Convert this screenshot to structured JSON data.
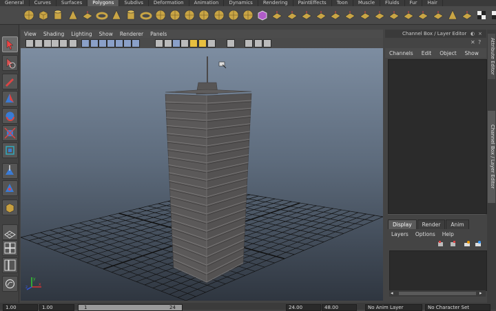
{
  "shelf": {
    "tabs": [
      "General",
      "Curves",
      "Surfaces",
      "Polygons",
      "Subdivs",
      "Deformation",
      "Animation",
      "Dynamics",
      "Rendering",
      "PaintEffects",
      "Toon",
      "Muscle",
      "Fluids",
      "Fur",
      "Hair"
    ],
    "active_tab": "Polygons"
  },
  "viewport": {
    "menus": [
      "View",
      "Shading",
      "Lighting",
      "Show",
      "Renderer",
      "Panels"
    ]
  },
  "channel_box": {
    "title": "Channel Box / Layer Editor",
    "menus": [
      "Channels",
      "Edit",
      "Object",
      "Show"
    ]
  },
  "side_tabs": [
    "Attribute Editor",
    "Channel Box / Layer Editor"
  ],
  "layer_editor": {
    "tabs": [
      "Display",
      "Render",
      "Anim"
    ],
    "active_tab": "Display",
    "menus": [
      "Layers",
      "Options",
      "Help"
    ]
  },
  "time_range": {
    "start_time": "1.00",
    "playback_start": "1.00",
    "range_start": "1",
    "range_end": "24",
    "playback_end": "24.00",
    "end_time": "48.00",
    "anim_layer": "No Anim Layer",
    "character_set": "No Character Set"
  },
  "colors": {
    "viewport_top": "#7d8da1",
    "viewport_bottom": "#2f3640",
    "building": "#5a5858",
    "grid": "#111111",
    "ui_dark": "#2b2b2b"
  }
}
